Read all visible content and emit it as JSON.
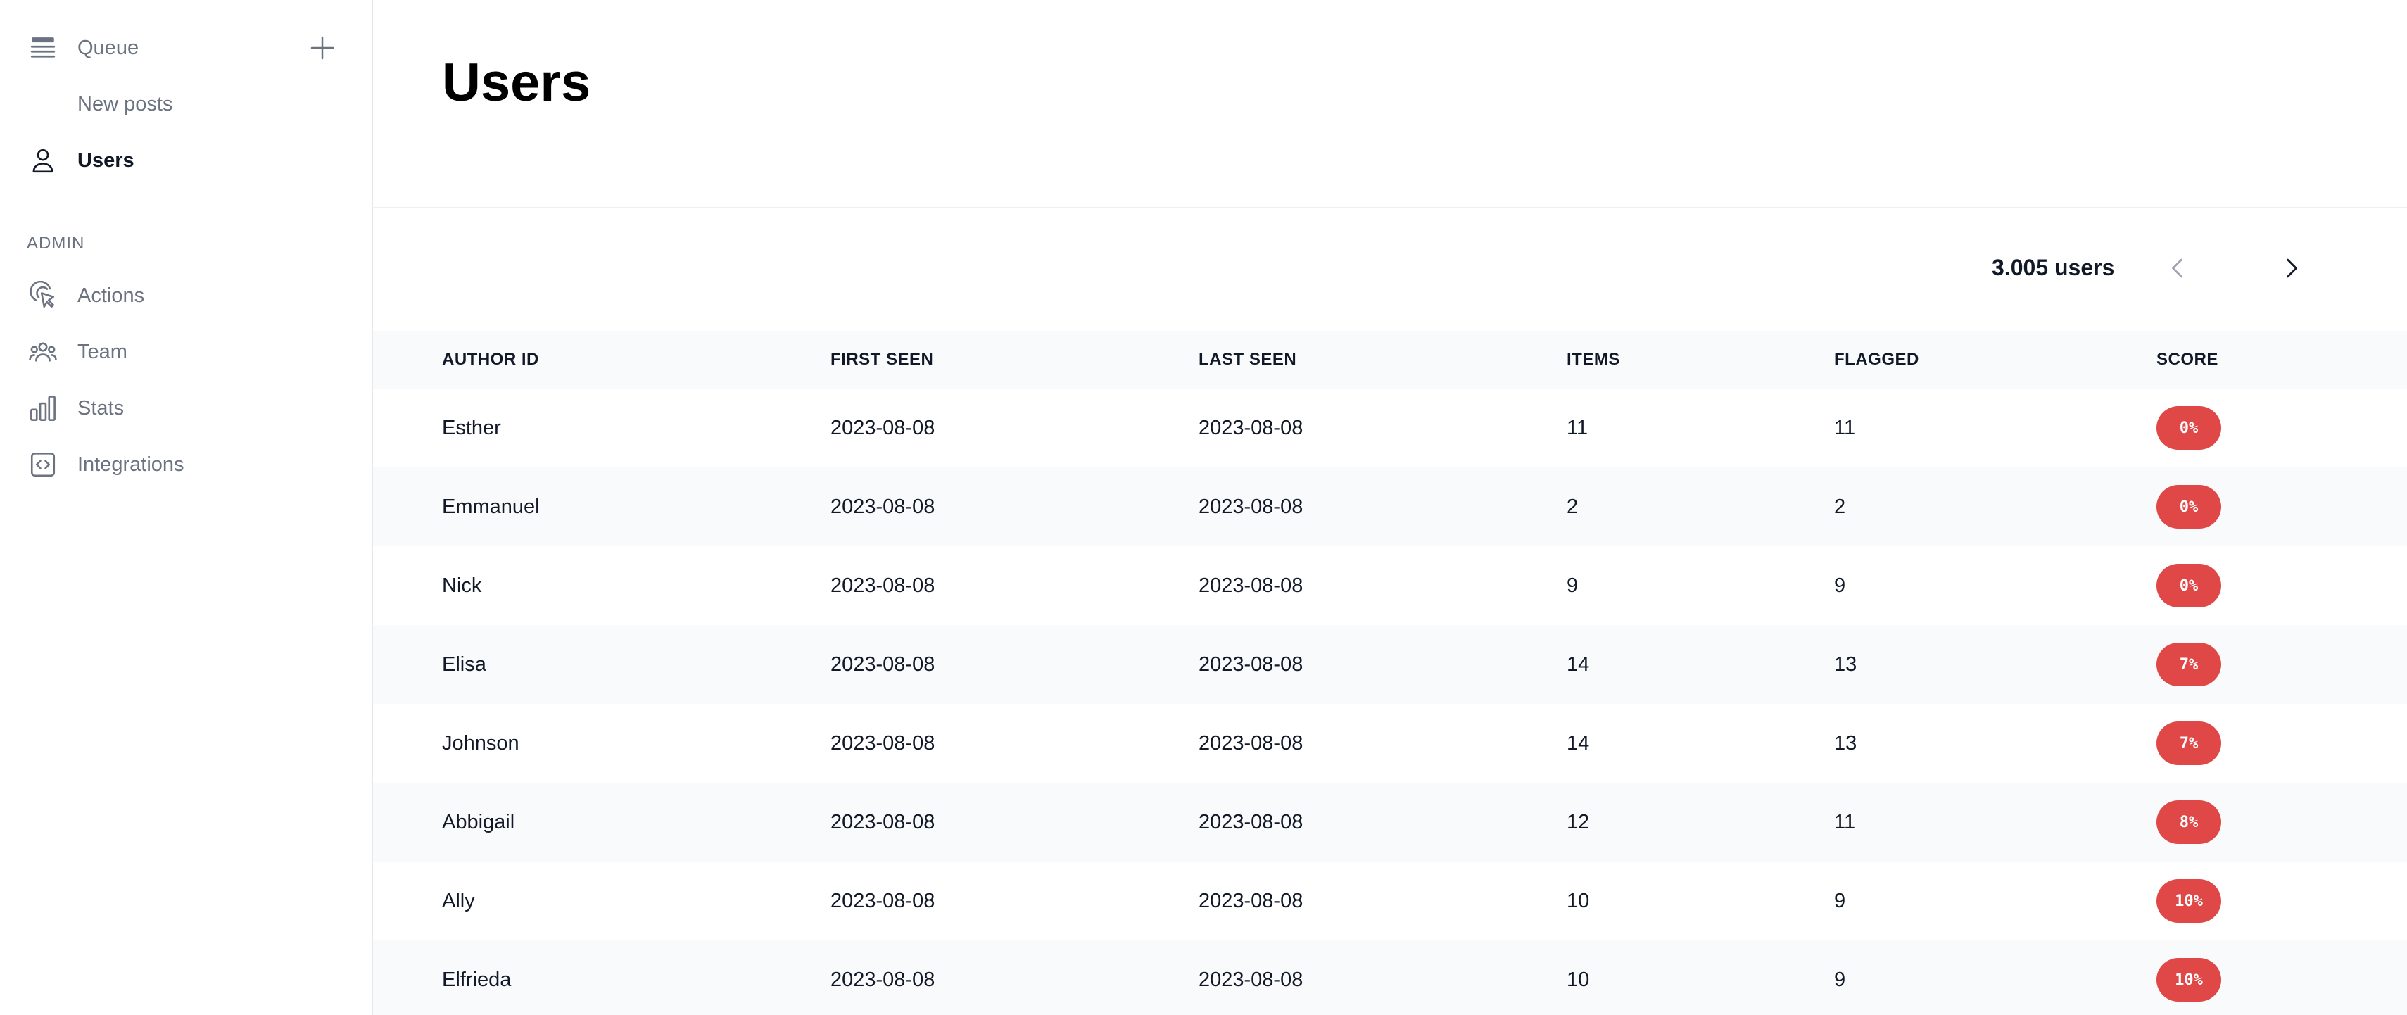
{
  "sidebar": {
    "queue": {
      "label": "Queue",
      "icon": "queue-list-icon"
    },
    "add": {
      "icon": "plus-icon"
    },
    "new_posts": {
      "label": "New posts"
    },
    "users": {
      "label": "Users",
      "icon": "user-icon"
    },
    "admin_section": "ADMIN",
    "admin_items": [
      {
        "label": "Actions",
        "icon": "cursor-click-icon"
      },
      {
        "label": "Team",
        "icon": "team-icon"
      },
      {
        "label": "Stats",
        "icon": "bar-chart-icon"
      },
      {
        "label": "Integrations",
        "icon": "code-bracket-icon"
      }
    ]
  },
  "main": {
    "title": "Users",
    "count_label": "3.005 users",
    "pager": {
      "prev_icon": "chevron-left-icon",
      "next_icon": "chevron-right-icon"
    }
  },
  "table": {
    "columns": [
      "AUTHOR ID",
      "FIRST SEEN",
      "LAST SEEN",
      "ITEMS",
      "FLAGGED",
      "SCORE"
    ],
    "rows": [
      {
        "author": "Esther",
        "first_seen": "2023-08-08",
        "last_seen": "2023-08-08",
        "items": "11",
        "flagged": "11",
        "score": "0%"
      },
      {
        "author": "Emmanuel",
        "first_seen": "2023-08-08",
        "last_seen": "2023-08-08",
        "items": "2",
        "flagged": "2",
        "score": "0%"
      },
      {
        "author": "Nick",
        "first_seen": "2023-08-08",
        "last_seen": "2023-08-08",
        "items": "9",
        "flagged": "9",
        "score": "0%"
      },
      {
        "author": "Elisa",
        "first_seen": "2023-08-08",
        "last_seen": "2023-08-08",
        "items": "14",
        "flagged": "13",
        "score": "7%"
      },
      {
        "author": "Johnson",
        "first_seen": "2023-08-08",
        "last_seen": "2023-08-08",
        "items": "14",
        "flagged": "13",
        "score": "7%"
      },
      {
        "author": "Abbigail",
        "first_seen": "2023-08-08",
        "last_seen": "2023-08-08",
        "items": "12",
        "flagged": "11",
        "score": "8%"
      },
      {
        "author": "Ally",
        "first_seen": "2023-08-08",
        "last_seen": "2023-08-08",
        "items": "10",
        "flagged": "9",
        "score": "10%"
      },
      {
        "author": "Elfrieda",
        "first_seen": "2023-08-08",
        "last_seen": "2023-08-08",
        "items": "10",
        "flagged": "9",
        "score": "10%"
      }
    ]
  },
  "colors": {
    "score_badge": "#e04848",
    "row_alt_bg": "#f9fafb",
    "muted_text": "#6b7280"
  }
}
